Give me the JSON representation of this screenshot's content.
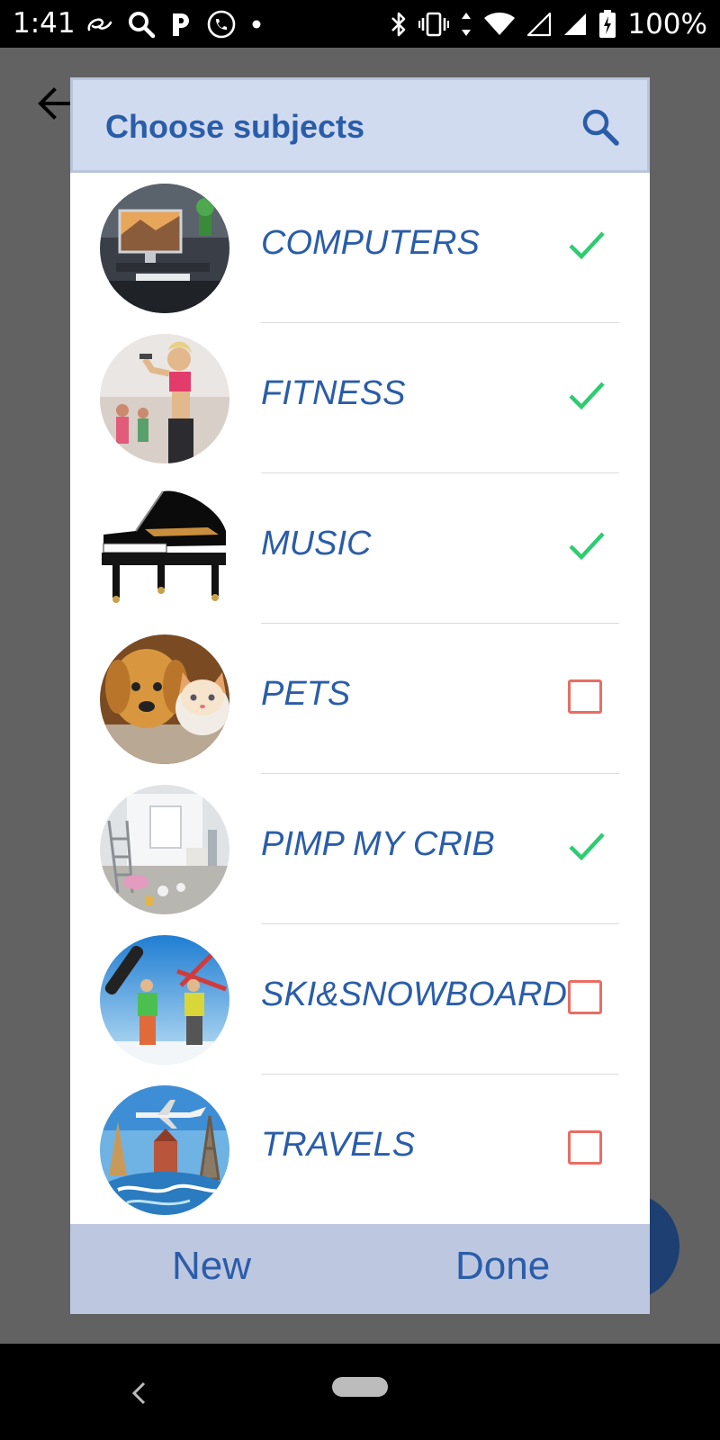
{
  "status_bar": {
    "time": "1:41",
    "battery_percent": "100%",
    "left_icons": [
      "alibaba-icon",
      "search-icon",
      "pandora-icon",
      "phone-icon",
      "dot-icon"
    ],
    "right_icons": [
      "bluetooth-icon",
      "vibrate-icon",
      "data-arrows-icon",
      "wifi-icon",
      "signal-icon",
      "signal-icon",
      "battery-icon"
    ]
  },
  "dialog": {
    "title": "Choose subjects",
    "search_icon": "search-icon",
    "subjects": [
      {
        "label": "COMPUTERS",
        "selected": true,
        "image": "computers-photo"
      },
      {
        "label": "FITNESS",
        "selected": true,
        "image": "fitness-photo"
      },
      {
        "label": "MUSIC",
        "selected": true,
        "image": "piano-photo"
      },
      {
        "label": "PETS",
        "selected": false,
        "image": "pets-photo"
      },
      {
        "label": "PIMP MY CRIB",
        "selected": true,
        "image": "room-photo"
      },
      {
        "label": "SKI&SNOWBOARD",
        "selected": false,
        "image": "ski-photo"
      },
      {
        "label": "TRAVELS",
        "selected": false,
        "image": "travel-photo"
      }
    ],
    "footer": {
      "new_label": "New",
      "done_label": "Done"
    }
  },
  "colors": {
    "accent": "#2a5da9",
    "check": "#2ecc71",
    "unchecked": "#e96d64",
    "header_bg": "#d1dbef",
    "footer_bg": "#bdc7e0"
  }
}
